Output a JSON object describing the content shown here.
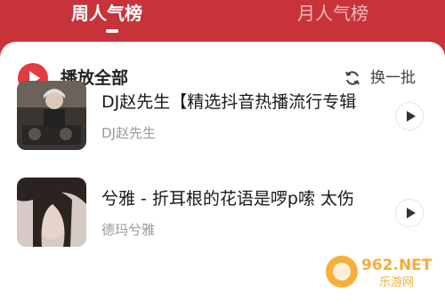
{
  "tabs": [
    {
      "label": "周人气榜",
      "active": true
    },
    {
      "label": "月人气榜",
      "active": false
    }
  ],
  "header": {
    "play_all_label": "播放全部",
    "refresh_label": "换一批"
  },
  "songs": [
    {
      "title": "DJ赵先生【精选抖音热播流行专辑",
      "artist": "DJ赵先生",
      "cover": "dj-cover"
    },
    {
      "title": "兮雅 - 折耳根的花语是啰p嗦 太伤",
      "artist": "德玛兮雅",
      "cover": "portrait-cover"
    }
  ],
  "watermark": {
    "brand": "962.NET",
    "sub": "乐游网"
  },
  "colors": {
    "accent": "#c8333a",
    "play_red": "#e33b3f"
  }
}
